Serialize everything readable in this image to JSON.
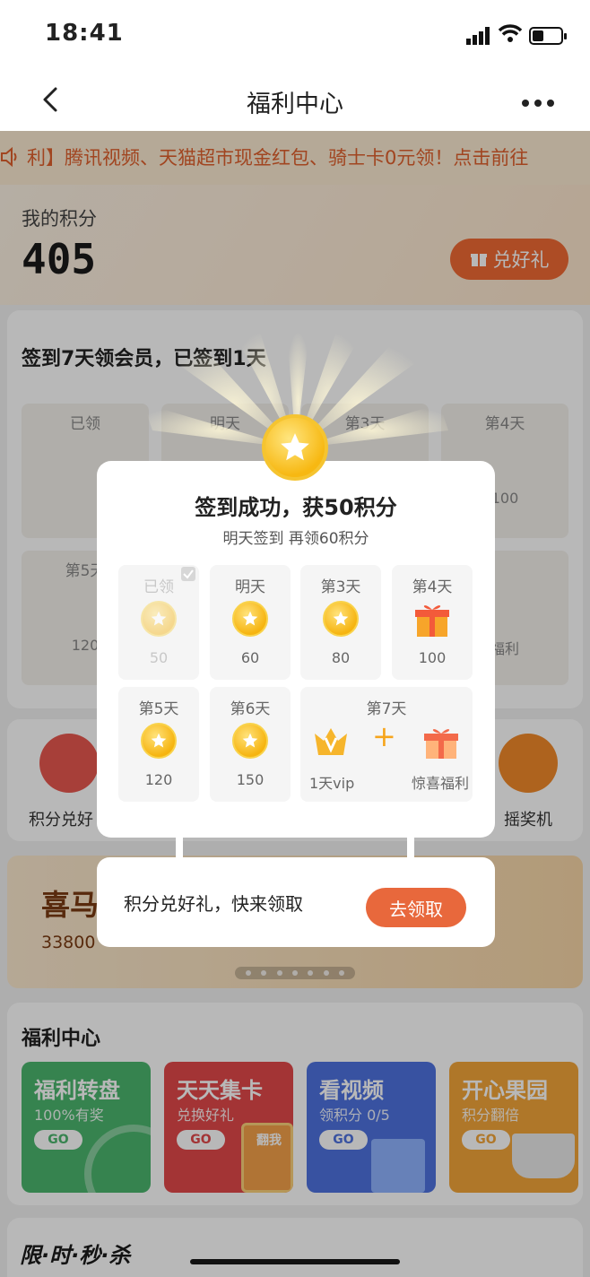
{
  "status_bar": {
    "time": "18:41"
  },
  "nav": {
    "title": "福利中心"
  },
  "ticker": {
    "text": "利】腾讯视频、天猫超市现金红包、骑士卡0元领！点击前往"
  },
  "points": {
    "label": "我的积分",
    "value": "405",
    "redeem_label": "兑好礼"
  },
  "sign_card": {
    "title": "签到7天领会员，已签到1天",
    "bg_days": [
      {
        "label": "已领",
        "value": "50"
      },
      {
        "label": "明天",
        "value": ""
      },
      {
        "label": "第3天",
        "value": ""
      },
      {
        "label": "第4天",
        "value": "100"
      },
      {
        "label": "第5天",
        "value": "120"
      },
      {
        "label": "",
        "value": "福利"
      }
    ]
  },
  "shortcuts": [
    {
      "label": "积分兑好",
      "color": "#e8584f"
    },
    {
      "label": "摇奖机",
      "color": "#f28a2a"
    }
  ],
  "banner": {
    "title": "喜马",
    "subtitle": "33800"
  },
  "welfare": {
    "title": "福利中心",
    "tiles": [
      {
        "title": "福利转盘",
        "subtitle": "100%有奖",
        "go": "GO",
        "color": "#4cb66e"
      },
      {
        "title": "天天集卡",
        "subtitle": "兑换好礼",
        "go": "GO",
        "color": "#e2484a",
        "extra": "翻我"
      },
      {
        "title": "看视频",
        "subtitle": "领积分 0/5",
        "go": "GO",
        "color": "#4e72e0"
      },
      {
        "title": "开心果园",
        "subtitle": "积分翻倍",
        "go": "GO",
        "color": "#f3a53a"
      }
    ]
  },
  "flash": {
    "title": "限·时·秒·杀"
  },
  "modal": {
    "title": "签到成功，获50积分",
    "subtitle": "明天签到 再领60积分",
    "days": [
      {
        "label": "已领",
        "value": "50",
        "state": "done"
      },
      {
        "label": "明天",
        "value": "60",
        "state": "coin"
      },
      {
        "label": "第3天",
        "value": "80",
        "state": "coin"
      },
      {
        "label": "第4天",
        "value": "100",
        "state": "gift"
      },
      {
        "label": "第5天",
        "value": "120",
        "state": "coin"
      },
      {
        "label": "第6天",
        "value": "150",
        "state": "coin"
      }
    ],
    "day7": {
      "label": "第7天",
      "vip_text": "1天vip",
      "plus": "+",
      "surprise_text": "惊喜福利"
    }
  },
  "tip": {
    "text": "积分兑好礼，快来领取",
    "button": "去领取"
  },
  "colors": {
    "accent": "#e8683c",
    "coin": "#f6b410"
  }
}
